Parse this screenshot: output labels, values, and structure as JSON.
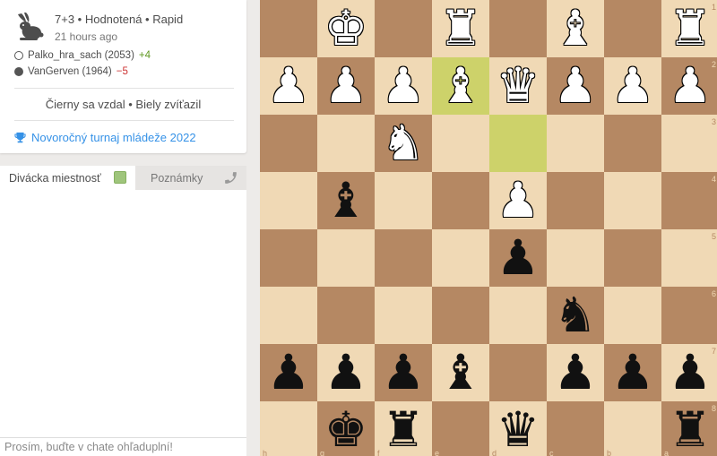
{
  "game": {
    "title": "7+3 • Hodnotená • Rapid",
    "time_ago": "21 hours ago",
    "icon": "rabbit-icon",
    "white": {
      "name": "Palko_hra_sach (2053)",
      "diff": "+4"
    },
    "black": {
      "name": "VanGerven (1964)",
      "diff": "−5"
    },
    "result": "Čierny sa vzdal • Biely zvíťazil",
    "tournament": "Novoročný turnaj mládeže 2022"
  },
  "chat": {
    "tab_room": "Divácka miestnosť",
    "tab_notes": "Poznámky",
    "placeholder": "Prosím, buďte v chate ohľaduplní!"
  },
  "board": {
    "orientation": "black",
    "light_color": "#f0d9b5",
    "dark_color": "#b58863",
    "highlight_color": "#cdd26a",
    "highlighted_squares": [
      "e2",
      "d3"
    ],
    "pieces": [
      {
        "square": "g1",
        "type": "king",
        "color": "white"
      },
      {
        "square": "e1",
        "type": "rook",
        "color": "white"
      },
      {
        "square": "c1",
        "type": "bishop",
        "color": "white"
      },
      {
        "square": "a1",
        "type": "rook",
        "color": "white"
      },
      {
        "square": "h2",
        "type": "pawn",
        "color": "white"
      },
      {
        "square": "g2",
        "type": "pawn",
        "color": "white"
      },
      {
        "square": "f2",
        "type": "pawn",
        "color": "white"
      },
      {
        "square": "e2",
        "type": "bishop",
        "color": "white"
      },
      {
        "square": "d2",
        "type": "queen",
        "color": "white"
      },
      {
        "square": "c2",
        "type": "pawn",
        "color": "white"
      },
      {
        "square": "b2",
        "type": "pawn",
        "color": "white"
      },
      {
        "square": "a2",
        "type": "pawn",
        "color": "white"
      },
      {
        "square": "f3",
        "type": "knight",
        "color": "white"
      },
      {
        "square": "g4",
        "type": "bishop",
        "color": "black"
      },
      {
        "square": "d4",
        "type": "pawn",
        "color": "white"
      },
      {
        "square": "d5",
        "type": "pawn",
        "color": "black"
      },
      {
        "square": "c6",
        "type": "knight",
        "color": "black"
      },
      {
        "square": "h7",
        "type": "pawn",
        "color": "black"
      },
      {
        "square": "g7",
        "type": "pawn",
        "color": "black"
      },
      {
        "square": "f7",
        "type": "pawn",
        "color": "black"
      },
      {
        "square": "e7",
        "type": "bishop",
        "color": "black"
      },
      {
        "square": "c7",
        "type": "pawn",
        "color": "black"
      },
      {
        "square": "b7",
        "type": "pawn",
        "color": "black"
      },
      {
        "square": "a7",
        "type": "pawn",
        "color": "black"
      },
      {
        "square": "g8",
        "type": "king",
        "color": "black"
      },
      {
        "square": "f8",
        "type": "rook",
        "color": "black"
      },
      {
        "square": "d8",
        "type": "queen",
        "color": "black"
      },
      {
        "square": "a8",
        "type": "rook",
        "color": "black"
      }
    ],
    "files_display": [
      "h",
      "g",
      "f",
      "e",
      "d",
      "c",
      "b",
      "a"
    ],
    "ranks_display": [
      "1",
      "2",
      "3",
      "4",
      "5",
      "6",
      "7",
      "8"
    ]
  }
}
